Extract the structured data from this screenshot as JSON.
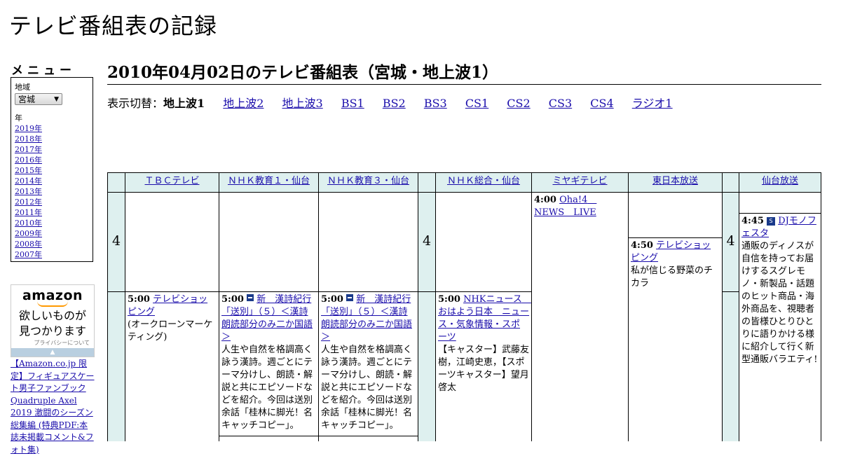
{
  "site": {
    "title": "テレビ番組表の記録"
  },
  "menu": {
    "heading": "メニュー",
    "region_label": "地域",
    "region_value": "宮城",
    "year_label": "年",
    "years": [
      "2019年",
      "2018年",
      "2017年",
      "2016年",
      "2015年",
      "2014年",
      "2013年",
      "2012年",
      "2011年",
      "2010年",
      "2009年",
      "2008年",
      "2007年"
    ]
  },
  "ad": {
    "logo": "amazon",
    "text_line1": "欲しいものが",
    "text_line2": "見つかります",
    "privacy": "プライバシーについて",
    "link": "【Amazon.co.jp 限定】フィギュアスケート男子ファンブック Quadruple Axel 2019 激闘のシーズン総集編 (特典PDF:本誌未掲載コメント&フォト集)"
  },
  "page": {
    "title": "2010年04月02日のテレビ番組表（宮城・地上波1）",
    "switch_label": "表示切替：",
    "switch_current": "地上波1",
    "switch_links": [
      "地上波2",
      "地上波3",
      "BS1",
      "BS2",
      "BS3",
      "CS1",
      "CS2",
      "CS3",
      "CS4",
      "ラジオ1"
    ]
  },
  "schedule": {
    "hours": [
      "4",
      "4"
    ],
    "channels": [
      "ＴＢＣテレビ",
      "ＮＨＫ教育１・仙台",
      "ＮＨＫ教育３・仙台",
      "ＮＨＫ総合・仙台",
      "ミヤギテレビ",
      "東日本放送",
      "仙台放送"
    ],
    "programs": {
      "tbc_500": {
        "time": "5:00",
        "title": "テレビショッピング",
        "desc": "(オークローンマーケティング)"
      },
      "etv1_500": {
        "time": "5:00",
        "title": "新　漢詩紀行「送別」（５）＜漢詩朗読部分のみ二か国語＞",
        "desc": "人生や自然を格調高く詠う漢詩。週ごとにテーマ分けし、朗読・解説と共にエピソードなどを紹介。今回は送別余話「桂林に脚光！名キャッチコピー」。"
      },
      "etv3_500": {
        "time": "5:00",
        "title": "新　漢詩紀行「送別」（５）＜漢詩朗読部分のみ二か国語＞",
        "desc": "人生や自然を格調高く詠う漢詩。週ごとにテーマ分けし、朗読・解説と共にエピソードなどを紹介。今回は送別余話「桂林に脚光！名キャッチコピー」。"
      },
      "nhk_500": {
        "time": "5:00",
        "title": "NHKニュース　おはよう日本　ニュース・気象情報・スポーツ",
        "desc": "【キャスター】武藤友樹，江崎史恵，【スポーツキャスター】望月啓太"
      },
      "miyagi_400": {
        "time": "4:00",
        "title": "Oha!4　NEWS　LIVE"
      },
      "khb_450": {
        "time": "4:50",
        "title": "テレビショッピング",
        "desc": "私が信じる野菜のチカラ"
      },
      "ox_445": {
        "time": "4:45",
        "title": "DJモノフェスタ",
        "desc": "通販のディノスが自信を持ってお届けするスグレモノ・新製品・話題のヒット商品・海外商品を、視聴者の皆様ひとりひとりに語りかける様に紹介して行く新型通販バラエティ!"
      }
    }
  },
  "colors": {
    "header_bg": "#def0ef",
    "link": "#1a0dab"
  }
}
